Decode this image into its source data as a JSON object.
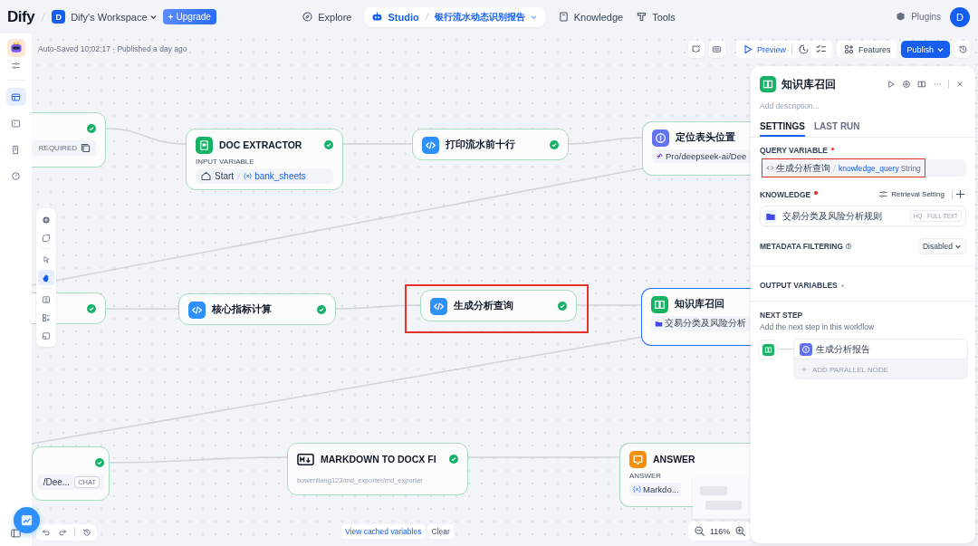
{
  "header": {
    "logo": "Dify",
    "workspace_initial": "D",
    "workspace": "Dify's Workspace",
    "upgrade": "Upgrade",
    "nav": [
      {
        "kind": "explore",
        "label": "Explore",
        "selected": false
      },
      {
        "kind": "studio",
        "label": "Studio",
        "selected": true,
        "app": "银行流水动态识别报告"
      },
      {
        "kind": "knowledge",
        "label": "Knowledge",
        "selected": false
      },
      {
        "kind": "tools",
        "label": "Tools",
        "selected": false
      }
    ],
    "plugins": "Plugins",
    "avatar": "D"
  },
  "sidebar": {
    "items": [
      {
        "kind": "orchestrate",
        "selected": true
      },
      {
        "kind": "logs",
        "selected": false
      },
      {
        "kind": "annotations",
        "selected": false
      },
      {
        "kind": "monitoring",
        "selected": false
      }
    ]
  },
  "canvas": {
    "status": "Auto-Saved 10:02:17 · Published a day ago",
    "preview": "Preview",
    "features": "Features",
    "publish": "Publish",
    "tools": [
      {
        "kind": "add",
        "selected": false
      },
      {
        "kind": "note",
        "selected": false
      },
      {
        "kind": "pointer",
        "selected": false
      },
      {
        "kind": "hand",
        "selected": true
      },
      {
        "kind": "export",
        "selected": false
      },
      {
        "kind": "layout",
        "selected": false
      },
      {
        "kind": "minimap",
        "selected": false
      }
    ],
    "cached": "View cached variables",
    "clear": "Clear",
    "zoom": "116%"
  },
  "nodes": [
    {
      "kind": "plain",
      "done": true,
      "selected": false,
      "field": {
        "kind": "required",
        "text": "REQUIRED"
      }
    },
    {
      "kind": "doc",
      "title": "DOC EXTRACTOR",
      "done": true,
      "selected": false,
      "label": "INPUT VARIABLE",
      "field": {
        "kind": "variable",
        "source": "Start",
        "var": "bank_sheets"
      }
    },
    {
      "kind": "code",
      "title": "打印流水前十行",
      "done": true,
      "selected": false
    },
    {
      "kind": "llm",
      "title": "定位表头位置",
      "done": false,
      "selected": false,
      "field": {
        "kind": "model",
        "text": "Pro/deepseek-ai/Dee"
      }
    },
    {
      "kind": "plain",
      "done": true,
      "selected": false
    },
    {
      "kind": "code",
      "title": "核心指标计算",
      "done": true,
      "selected": false
    },
    {
      "kind": "code",
      "title": "生成分析查询",
      "done": true,
      "selected": false,
      "highlighted": true
    },
    {
      "kind": "knowledge",
      "title": "知识库召回",
      "done": false,
      "selected": true,
      "field": {
        "kind": "dataset",
        "text": "交易分类及风险分析"
      }
    },
    {
      "kind": "plain",
      "done": true,
      "selected": false,
      "field": {
        "kind": "model",
        "text": "/Dee...",
        "tag": "CHAT"
      }
    },
    {
      "kind": "markdown",
      "title": "MARKDOWN TO DOCX FI",
      "done": true,
      "selected": false,
      "subtitle": "bowenliang123/md_exporter/md_exporter"
    },
    {
      "kind": "answer",
      "title": "ANSWER",
      "done": false,
      "selected": false,
      "label": "ANSWER",
      "field": {
        "kind": "var",
        "text": "Markdo..."
      }
    }
  ],
  "panel": {
    "title": "知识库召回",
    "description_placeholder": "Add description...",
    "tabs": [
      {
        "label": "SETTINGS",
        "selected": true
      },
      {
        "label": "LAST RUN",
        "selected": false
      }
    ],
    "query_variable": {
      "label": "QUERY VARIABLE",
      "required": true,
      "highlighted": true,
      "node": "生成分析查询",
      "var": "knowledge_query",
      "type": "String"
    },
    "knowledge": {
      "label": "KNOWLEDGE",
      "required": true,
      "retrieval": "Retrieval Setting",
      "items": [
        {
          "name": "交易分类及风险分析规则",
          "badge": "HQ · FULL TEXT"
        }
      ]
    },
    "metadata": {
      "label": "METADATA FILTERING",
      "value": "Disabled"
    },
    "output": "OUTPUT VARIABLES",
    "next_step": {
      "title": "NEXT STEP",
      "hint": "Add the next step in this workflow",
      "nodes": [
        {
          "title": "生成分析报告"
        }
      ],
      "add_parallel": "ADD PARALLEL NODE"
    }
  }
}
